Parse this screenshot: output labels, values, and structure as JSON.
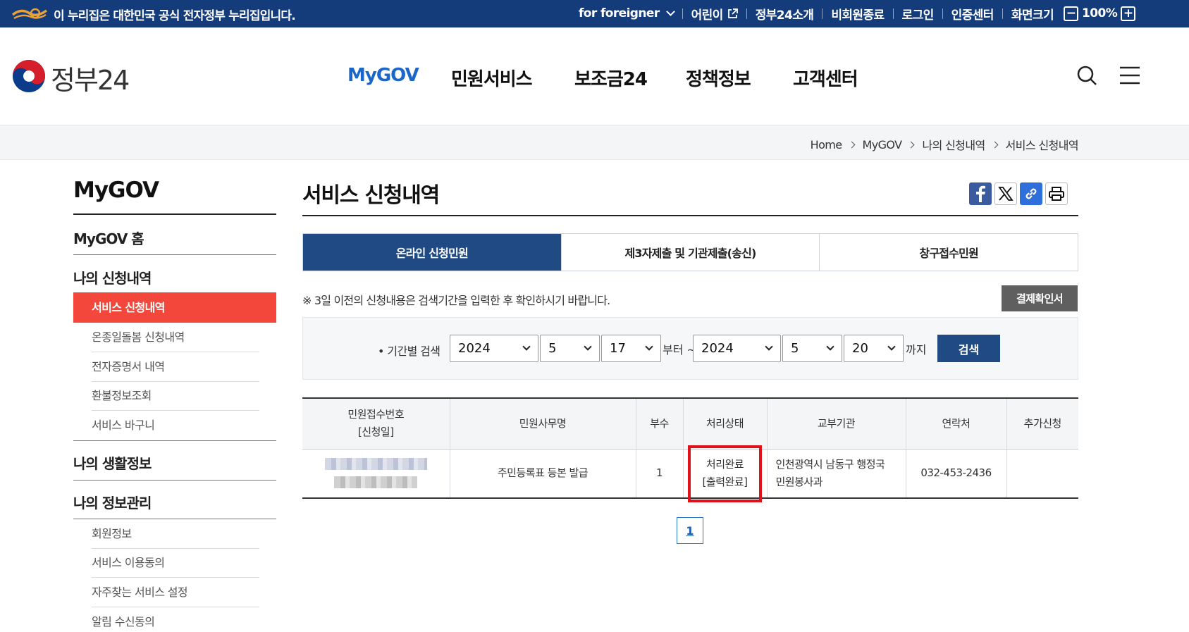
{
  "gov_banner": {
    "notice": "이 누리집은 대한민국 공식 전자정부 누리집입니다.",
    "foreigner": "for foreigner",
    "children": "어린이",
    "about": "정부24소개",
    "withdraw": "비회원종료",
    "login": "로그인",
    "cert_center": "인증센터",
    "screen_size": "화면크기",
    "zoom_minus": "−",
    "zoom_level": "100%",
    "zoom_plus": "+"
  },
  "header": {
    "logo_text": "정부24",
    "nav": [
      "MyGOV",
      "민원서비스",
      "보조금24",
      "정책정보",
      "고객센터"
    ],
    "active_nav": "MyGOV",
    "icons": [
      "search-icon",
      "menu-icon"
    ]
  },
  "breadcrumb": [
    "Home",
    "MyGOV",
    "나의 신청내역",
    "서비스 신청내역"
  ],
  "sidebar": {
    "title": "MyGOV",
    "home": "MyGOV 홈",
    "group1": "나의 신청내역",
    "group1_items": [
      "서비스 신청내역",
      "온종일돌봄 신청내역",
      "전자증명서 내역",
      "환불정보조회",
      "서비스 바구니"
    ],
    "group2": "나의 생활정보",
    "group3": "나의 정보관리",
    "group3_items": [
      "회원정보",
      "서비스 이용동의",
      "자주찾는 서비스 설정",
      "알림 수신동의"
    ]
  },
  "main": {
    "title": "서비스 신청내역",
    "share_icons": [
      "facebook-icon",
      "x-icon",
      "link-icon",
      "print-icon"
    ],
    "tabs": [
      "온라인 신청민원",
      "제3자제출 및 기관제출(송신)",
      "창구접수민원"
    ],
    "notice": "※ 3일 이전의 신청내용은 검색기간을 입력한 후 확인하시기 바랍니다.",
    "pay_button": "결제확인서",
    "search": {
      "label": "• 기간별 검색",
      "from_year": "2024",
      "from_month": "5",
      "from_day": "17",
      "from_text": "부터 ~",
      "to_year": "2024",
      "to_month": "5",
      "to_day": "20",
      "to_text": "까지",
      "button": "검색"
    },
    "table": {
      "headers": {
        "receipt_no": "민원접수번호",
        "receipt_date": "[신청일]",
        "service": "민원사무명",
        "copies": "부수",
        "status": "처리상태",
        "issuer": "교부기관",
        "contact": "연락처",
        "extra": "추가신청"
      },
      "rows": [
        {
          "service": "주민등록표 등본 발급",
          "copies": "1",
          "status": "처리완료",
          "status_sub": "[출력완료]",
          "issuer": "인천광역시 남동구 행정국 민원봉사과",
          "contact": "032-453-2436",
          "extra": ""
        }
      ]
    },
    "pagination": [
      "1"
    ]
  },
  "colors": {
    "gov_bar": "#143b7a",
    "accent_blue": "#1f4a84",
    "active_nav": "#1a66c9",
    "sidebar_active": "#f2473a",
    "highlight": "#e0111b"
  }
}
